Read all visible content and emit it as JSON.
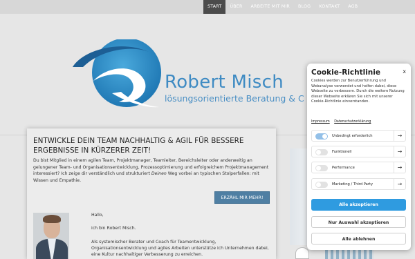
{
  "nav": {
    "items": [
      {
        "label": "START",
        "active": true
      },
      {
        "label": "ÜBER",
        "active": false
      },
      {
        "label": "ARBEITE MIT MIR",
        "active": false
      },
      {
        "label": "BLOG",
        "active": false
      },
      {
        "label": "KONTAKT",
        "active": false
      },
      {
        "label": "AGB",
        "active": false
      }
    ]
  },
  "logo": {
    "name": "Robert Misch",
    "tagline": "lösungsorientierte Beratung & C"
  },
  "main": {
    "title": "ENTWICKLE DEIN TEAM NACHHALTIG & AGIL FÜR BESSERE ERGEBNISSE IN KÜRZERER ZEIT!",
    "intro_text_a": "Du bist Mitglied in einem agilen Team, Projektmanager, Teamleiter, Bereichsleiter oder anderweitig an gelungener Team- und Organisationsentwicklung, Prozessoptimierung und erfolgreichem Projektmanagement interessiert? Ich zeige dir verständlich und strukturiert ",
    "intro_text_em": "Deinen",
    "intro_text_b": " Weg vorbei an typischen Stolperfallen: mit Wissen und Empathie.",
    "cta_label": "ERZÄHL MIR MEHR!",
    "greeting": "Hallo,",
    "intro_name": "ich bin Robert Misch.",
    "paragraph2": "Als systemischer Berater und Coach für Teamentwicklung, Organisationsentwicklung und agiles Arbeiten unterstütze ich Unternehmen dabei, eine Kultur nachhaltiger Verbesserung zu erreichen."
  },
  "cookie": {
    "title": "Cookie-Richtlinie",
    "close": "x",
    "text": "Cookies werden zur Benutzerführung und Webanalyse verwendet und helfen dabei, diese Webseite zu verbessern. Durch die weitere Nutzung dieser Webseite erklären Sie sich mit unserer Cookie-Richtlinie einverstanden.",
    "link_impressum": "Impressum",
    "link_datenschutz": "Datenschutzerklärung",
    "categories": [
      {
        "label": "Unbedingt erforderlich",
        "enabled": true
      },
      {
        "label": "Funktionell",
        "enabled": false
      },
      {
        "label": "Performance",
        "enabled": false
      },
      {
        "label": "Marketing / Third Party",
        "enabled": false
      }
    ],
    "arrow": "→",
    "btn_accept_all": "Alle akzeptieren",
    "btn_accept_selection": "Nur Auswahl akzeptieren",
    "btn_reject_all": "Alle ablehnen"
  },
  "colors": {
    "brand_blue": "#3f8bc3",
    "cta_blue": "#4f7fa3",
    "cookie_primary": "#2f9be0"
  }
}
